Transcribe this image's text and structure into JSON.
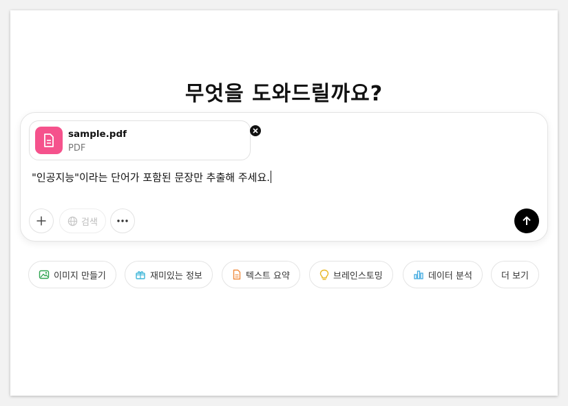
{
  "main": {
    "title": "무엇을 도와드릴까요?"
  },
  "attachment": {
    "file_name": "sample.pdf",
    "file_type": "PDF",
    "icon": "document-icon"
  },
  "composer": {
    "prompt_text": "\"인공지능\"이라는 단어가 포함된 문장만 추출해 주세요.",
    "search_label": "검색",
    "icons": [
      "plus-icon",
      "globe-icon",
      "more-icon",
      "arrow-up-icon",
      "close-icon"
    ]
  },
  "suggestions": [
    {
      "label": "이미지 만들기",
      "icon": "image-icon",
      "color": "#2ea44f"
    },
    {
      "label": "재미있는 정보",
      "icon": "gift-icon",
      "color": "#3fb6d8"
    },
    {
      "label": "텍스트 요약",
      "icon": "document-icon",
      "color": "#f08a3e"
    },
    {
      "label": "브레인스토밍",
      "icon": "lightbulb-icon",
      "color": "#e8b621"
    },
    {
      "label": "데이터 분석",
      "icon": "bar-chart-icon",
      "color": "#3fa9e0"
    },
    {
      "label": "더 보기",
      "icon": "",
      "color": ""
    }
  ],
  "colors": {
    "file_icon_bg": "#f5528c",
    "send_button": "#000000"
  }
}
